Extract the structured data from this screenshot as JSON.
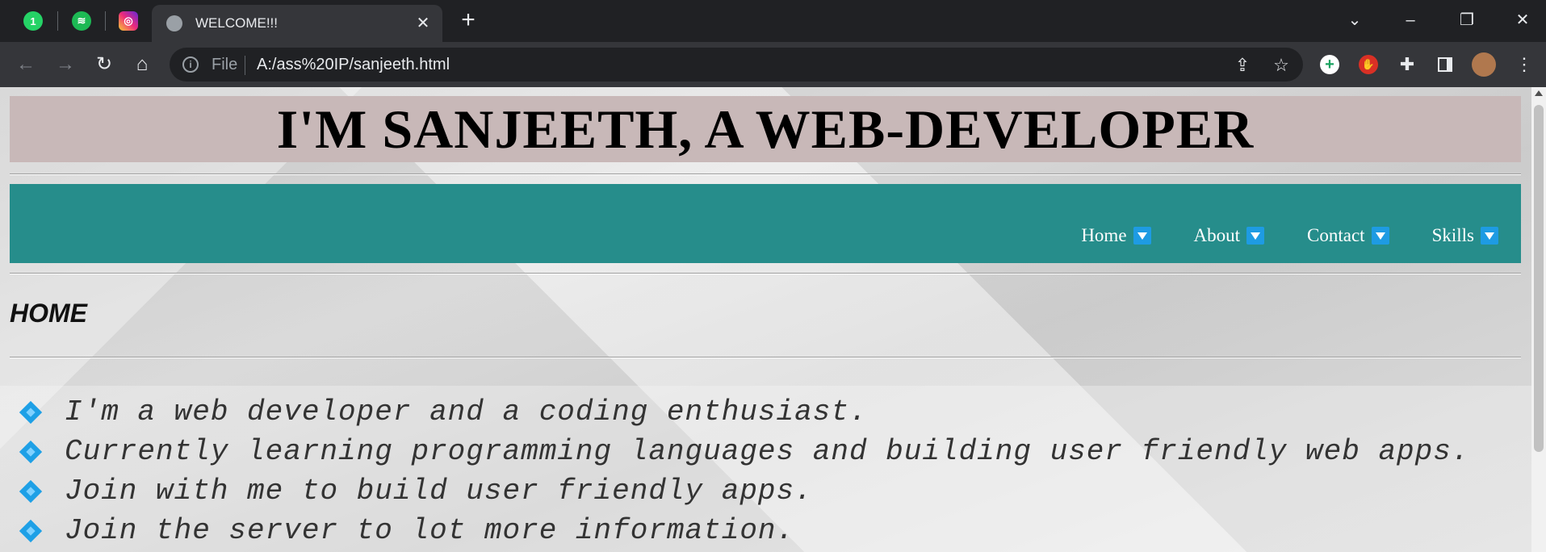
{
  "browser": {
    "pinned_tabs": [
      {
        "name": "whatsapp",
        "badge": "1",
        "color": "#25d366"
      },
      {
        "name": "spotify",
        "color": "#1db954"
      },
      {
        "name": "instagram",
        "color": "#e1306c"
      }
    ],
    "active_tab": {
      "title": "WELCOME!!!"
    },
    "address": {
      "scheme_label": "File",
      "url": "A:/ass%20IP/sanjeeth.html"
    }
  },
  "page": {
    "header_title": "I'M SANJEETH, A WEB-DEVELOPER",
    "nav_items": [
      "Home",
      "About",
      "Contact",
      "Skills"
    ],
    "section_title": "HOME",
    "bullets": [
      "I'm a web developer and a coding enthusiast.",
      "Currently learning programming languages and building user friendly web apps.",
      "Join with me to build user friendly apps.",
      "Join the server to lot more information."
    ],
    "colors": {
      "header_band": "#c8b8b8",
      "navbar": "#268d8b",
      "dropdown": "#1e9be3",
      "bullet": "#1ea0e6"
    }
  }
}
